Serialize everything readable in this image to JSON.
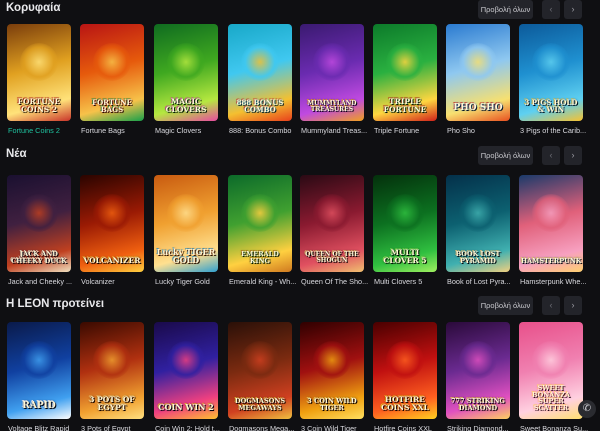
{
  "sections": [
    {
      "title": "Κορυφαία",
      "view_all": "Προβολή όλων",
      "games": [
        {
          "name": "Fortune Coins 2",
          "logo": "FORTUNE COINS 2",
          "active": true
        },
        {
          "name": "Fortune Bags",
          "logo": "FORTUNE BAGS"
        },
        {
          "name": "Magic Clovers",
          "logo": "MAGIC CLOVERS"
        },
        {
          "name": "888: Bonus Combo",
          "logo": "888 BONUS COMBO"
        },
        {
          "name": "Mummyland Treas...",
          "logo": "MUMMYLAND TREASURES"
        },
        {
          "name": "Triple Fortune",
          "logo": "TRIPLE FORTUNE"
        },
        {
          "name": "Pho Sho",
          "logo": "PHO SHO"
        },
        {
          "name": "3 Pigs of the Carib...",
          "logo": "3 PIGS HOLD & WIN"
        }
      ]
    },
    {
      "title": "Νέα",
      "view_all": "Προβολή όλων",
      "games": [
        {
          "name": "Jack and Cheeky ...",
          "logo": "JACK AND CHEEKY DUCK"
        },
        {
          "name": "Volcanizer",
          "logo": "VOLCANIZER"
        },
        {
          "name": "Lucky Tiger Gold",
          "logo": "Lucky TIGER GOLD"
        },
        {
          "name": "Emerald King - Wh...",
          "logo": "EMERALD KING"
        },
        {
          "name": "Queen Of The Sho...",
          "logo": "QUEEN OF THE SHOGUN"
        },
        {
          "name": "Multi Clovers 5",
          "logo": "MULTI CLOVER 5"
        },
        {
          "name": "Book of Lost Pyra...",
          "logo": "BOOK LOST PYRAMID"
        },
        {
          "name": "Hamsterpunk Whe...",
          "logo": "HAMSTERPUNK"
        }
      ]
    },
    {
      "title": "Η LEON προτείνει",
      "view_all": "Προβολή όλων",
      "games": [
        {
          "name": "Voltage Blitz Rapid",
          "logo": "RAPID"
        },
        {
          "name": "3 Pots of Egypt",
          "logo": "3 POTS OF EGYPT"
        },
        {
          "name": "Coin Win 2: Hold t...",
          "logo": "COIN WIN 2"
        },
        {
          "name": "Dogmasons Mega...",
          "logo": "DOGMASONS MEGAWAYS"
        },
        {
          "name": "3 Coin Wild Tiger",
          "logo": "3 COIN WILD TIGER"
        },
        {
          "name": "Hotfire Coins XXL",
          "logo": "HOTFIRE COINS XXL"
        },
        {
          "name": "Striking Diamond...",
          "logo": "777 STRIKING DIAMOND"
        },
        {
          "name": "Sweet Bonanza Su...",
          "logo": "SWEET BONANZA SUPER SCATTER"
        }
      ]
    }
  ],
  "colors": {
    "background": "#0f0f12",
    "button_bg": "#23242a",
    "active_text": "#1fc4a0",
    "thumb_gradients": [
      [
        "#7a3d0c",
        "#e0a020",
        "#ffe27a",
        "#c9342a"
      ],
      [
        "#b81414",
        "#e65a0c",
        "#f7c24a",
        "#17a04a"
      ],
      [
        "#0f6b20",
        "#3fa820",
        "#b6e840",
        "#e84aa0"
      ],
      [
        "#18a8c8",
        "#40c8f0",
        "#f4c030",
        "#e8401c"
      ],
      [
        "#3a1a70",
        "#6a2bb0",
        "#c04ae0",
        "#f0a020"
      ],
      [
        "#0c7a2a",
        "#2ab040",
        "#ffd640",
        "#d0201a"
      ],
      [
        "#2a7ad0",
        "#8fc8f0",
        "#f7e070",
        "#e85020"
      ],
      [
        "#0c5a9a",
        "#1f90d0",
        "#5fd0f0",
        "#f7c230"
      ],
      [
        "#1a1030",
        "#402040",
        "#c04020",
        "#f0e0c0"
      ],
      [
        "#2a0400",
        "#9a1a04",
        "#f06010",
        "#ffd040"
      ],
      [
        "#c85a10",
        "#f0a030",
        "#ffe090",
        "#30a0d0"
      ],
      [
        "#0c6a2a",
        "#40a030",
        "#ffd040",
        "#d07a20"
      ],
      [
        "#2a0a14",
        "#8a1a30",
        "#e05060",
        "#f0c070"
      ],
      [
        "#04300c",
        "#0c7020",
        "#30c040",
        "#a0f060"
      ],
      [
        "#04304a",
        "#0c6070",
        "#40b0b0",
        "#f0d080"
      ],
      [
        "#1a3a6a",
        "#e0607a",
        "#f7a0c0",
        "#ffd070"
      ],
      [
        "#0a1a4a",
        "#1040a0",
        "#40a0f0",
        "#ffffff"
      ],
      [
        "#3a0a00",
        "#b03010",
        "#f0a030",
        "#ffe080"
      ],
      [
        "#1a0a4a",
        "#3020a0",
        "#f04080",
        "#ffc030"
      ],
      [
        "#2a1008",
        "#7a2a10",
        "#d04020",
        "#f0c040"
      ],
      [
        "#300000",
        "#a01010",
        "#f0a010",
        "#ffe060"
      ],
      [
        "#4a0000",
        "#c01010",
        "#ff6020",
        "#ffd020"
      ],
      [
        "#2a0a3a",
        "#6a2a90",
        "#e050c0",
        "#ffd060"
      ],
      [
        "#e8508a",
        "#f080b0",
        "#ffd0e0",
        "#ffe070"
      ]
    ]
  },
  "chat_icon": "chat-icon"
}
